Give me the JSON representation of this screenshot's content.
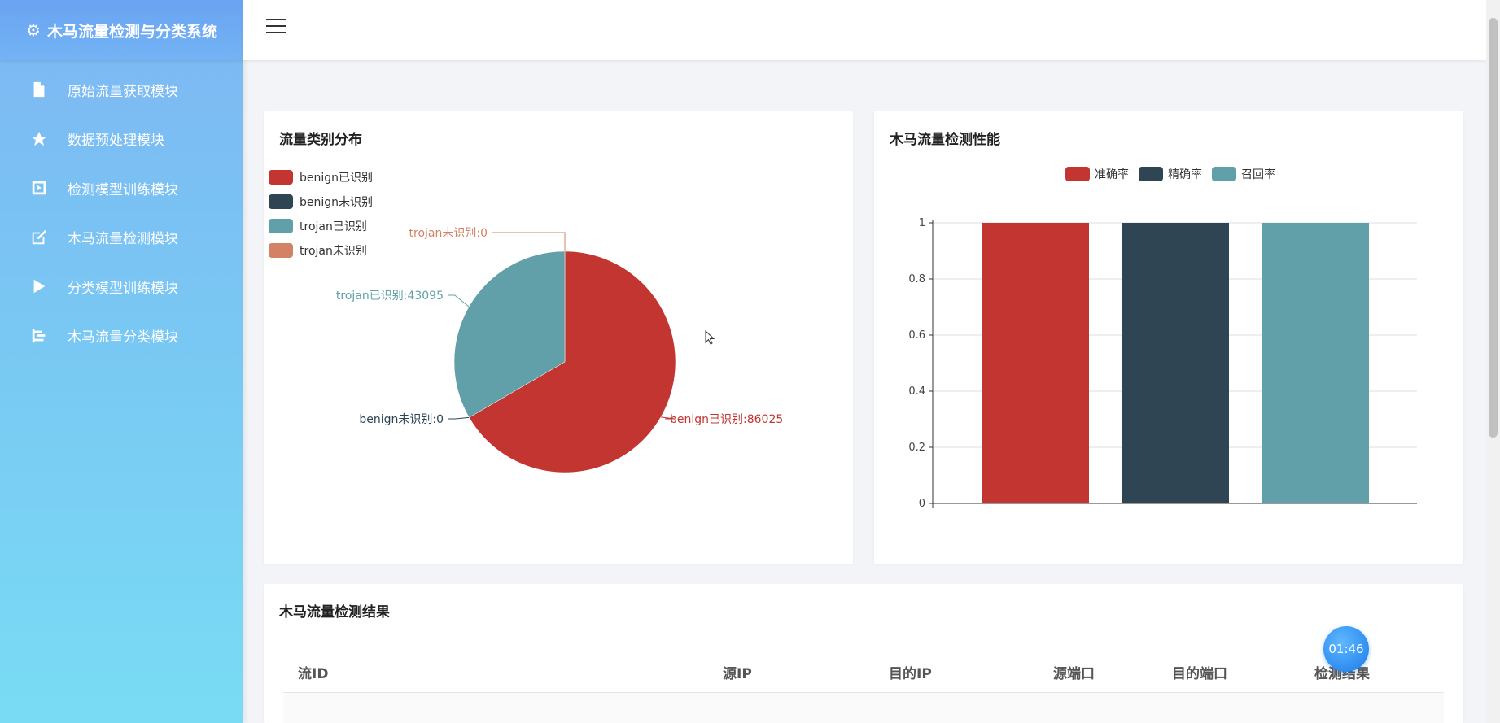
{
  "app": {
    "title": "木马流量检测与分类系统",
    "icon": "gear-icon"
  },
  "sidebar": {
    "items": [
      {
        "label": "原始流量获取模块",
        "icon": "file-icon"
      },
      {
        "label": "数据预处理模块",
        "icon": "star-icon"
      },
      {
        "label": "检测模型训练模块",
        "icon": "play-square-icon"
      },
      {
        "label": "木马流量检测模块",
        "icon": "edit-icon"
      },
      {
        "label": "分类模型训练模块",
        "icon": "play-icon"
      },
      {
        "label": "木马流量分类模块",
        "icon": "tree-icon"
      }
    ]
  },
  "pie_card": {
    "title": "流量类别分布"
  },
  "bar_card": {
    "title": "木马流量检测性能"
  },
  "table_card": {
    "title": "木马流量检测结果",
    "columns": [
      "流ID",
      "源IP",
      "目的IP",
      "源端口",
      "目的端口",
      "检测结果"
    ]
  },
  "timer": {
    "text": "01:46"
  },
  "colors": {
    "red": "#c23531",
    "dark": "#2f4554",
    "teal": "#61a0a8",
    "orange": "#d48265"
  },
  "chart_data": [
    {
      "type": "pie",
      "title": "流量类别分布",
      "legend_position": "top-left",
      "slices": [
        {
          "name": "benign已识别",
          "value": 86025,
          "label": "benign已识别:86025",
          "color": "#c23531"
        },
        {
          "name": "benign未识别",
          "value": 0,
          "label": "benign未识别:0",
          "color": "#2f4554"
        },
        {
          "name": "trojan已识别",
          "value": 43095,
          "label": "trojan已识别:43095",
          "color": "#61a0a8"
        },
        {
          "name": "trojan未识别",
          "value": 0,
          "label": "trojan未识别:0",
          "color": "#d48265"
        }
      ]
    },
    {
      "type": "bar",
      "title": "木马流量检测性能",
      "legend_position": "top-center",
      "categories": [
        ""
      ],
      "series": [
        {
          "name": "准确率",
          "values": [
            1
          ],
          "color": "#c23531"
        },
        {
          "name": "精确率",
          "values": [
            1
          ],
          "color": "#2f4554"
        },
        {
          "name": "召回率",
          "values": [
            1
          ],
          "color": "#61a0a8"
        }
      ],
      "ylim": [
        0,
        1
      ],
      "yticks": [
        "0",
        "0.2",
        "0.4",
        "0.6",
        "0.8",
        "1"
      ],
      "grid": true
    }
  ]
}
